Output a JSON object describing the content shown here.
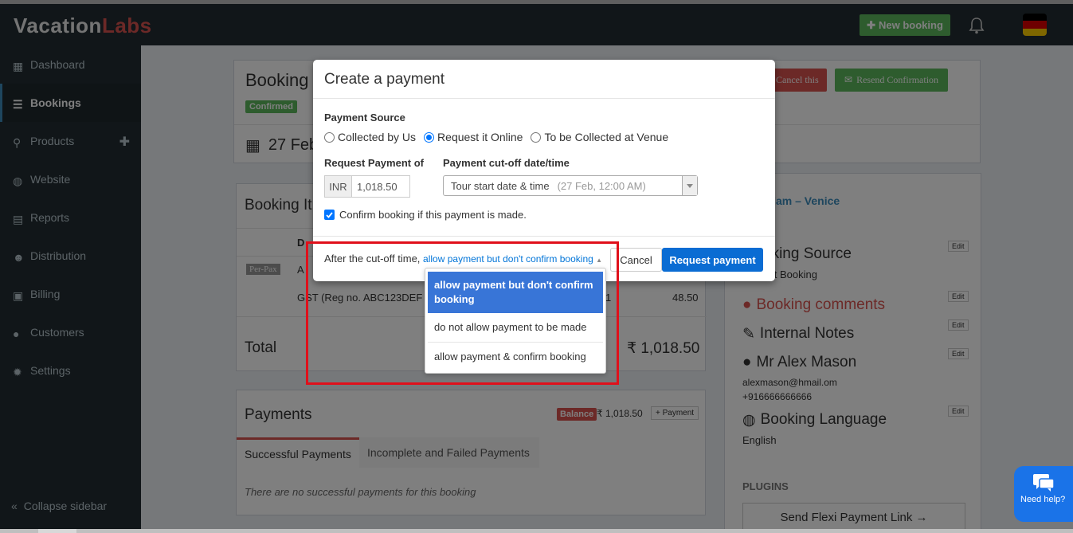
{
  "app": {
    "logo_a": "Vacation",
    "logo_b": "Labs",
    "new_booking": "New booking"
  },
  "sidebar": {
    "items": [
      {
        "label": "Dashboard",
        "icon": "dashboard-icon"
      },
      {
        "label": "Bookings",
        "icon": "list-icon",
        "active": true
      },
      {
        "label": "Products",
        "icon": "pin-icon"
      },
      {
        "label": "Website",
        "icon": "globe-icon"
      },
      {
        "label": "Reports",
        "icon": "file-icon"
      },
      {
        "label": "Distribution",
        "icon": "users-icon"
      },
      {
        "label": "Billing",
        "icon": "money-icon"
      },
      {
        "label": "Customers",
        "icon": "user-icon"
      },
      {
        "label": "Settings",
        "icon": "gear-icon"
      }
    ],
    "collapse": "Collapse sidebar"
  },
  "background": {
    "booking_title": "Booking",
    "status": "Confirmed",
    "date": "27 Feb",
    "cancel": "Cancel this",
    "resend": "Resend Confirmation",
    "items_title": "Booking It",
    "col_d": "D",
    "perpax": "Per-Pax",
    "row_a": "A",
    "gst": "GST (Reg no. ABC123DEF",
    "gst_qty": "1",
    "gst_amount": "48.50",
    "total_label": "Total",
    "total_value": "₹ 1,018.50",
    "trip": "rdam – Venice",
    "booking_source": "oking Source",
    "source_value": "ect Booking",
    "comments": "Booking comments",
    "internal_notes": "Internal Notes",
    "customer_name": "Mr Alex Mason",
    "email": "alexmason@hmail.om",
    "phone": "+916666666666",
    "language_title": "Booking Language",
    "language": "English",
    "edit": "Edit",
    "payments_title": "Payments",
    "balance_badge": "Balance",
    "balance_value": "₹ 1,018.50",
    "add_payment": "+ Payment",
    "tab_successful": "Successful Payments",
    "tab_failed": "Incomplete and Failed Payments",
    "no_payments": "There are no successful payments for this booking",
    "plugins": "PLUGINS",
    "flexi": "Send Flexi Payment Link →"
  },
  "modal": {
    "title": "Create a payment",
    "payment_source_label": "Payment Source",
    "sources": [
      "Collected by Us",
      "Request it Online",
      "To be Collected at Venue"
    ],
    "selected_source": "Request it Online",
    "request_label": "Request Payment of",
    "currency": "INR",
    "amount": "1,018.50",
    "cutoff_label": "Payment cut-off date/time",
    "cutoff_value": "Tour start date & time",
    "cutoff_detail": "(27 Feb, 12:00 AM)",
    "confirm_checkbox": "Confirm booking if this payment is made.",
    "after_cutoff_prefix": "After the cut-off time,",
    "after_cutoff_value": "allow payment but don't confirm booking",
    "cancel": "Cancel",
    "request_payment": "Request payment"
  },
  "dropdown": {
    "options": [
      "allow payment but don't confirm booking",
      "do not allow payment to be made",
      "allow payment & confirm booking"
    ],
    "selected": "allow payment but don't confirm booking"
  },
  "chat": {
    "label": "Need help?"
  },
  "colors": {
    "primary": "#0a6cd3",
    "highlight": "#e0101b",
    "success": "#5cb85c",
    "danger": "#d9534f"
  }
}
